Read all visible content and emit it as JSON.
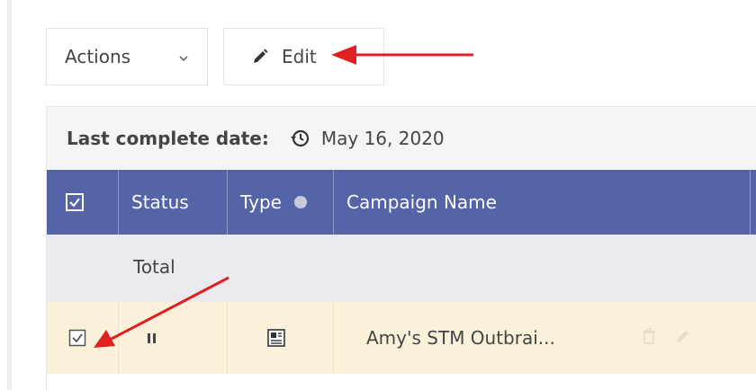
{
  "toolbar": {
    "actions_label": "Actions",
    "edit_label": "Edit"
  },
  "panel": {
    "date_label": "Last complete date:",
    "date_value": "May 16, 2020"
  },
  "table": {
    "columns": [
      "Status",
      "Type",
      "Campaign Name"
    ],
    "total_label": "Total",
    "rows": [
      {
        "selected": true,
        "status": "paused",
        "type_icon": "native-ad-icon",
        "campaign_name": "Amy's STM Outbrai..."
      }
    ]
  },
  "colors": {
    "header_bg": "#5464a6",
    "row_highlight": "#fbf1da",
    "total_row_bg": "#ebebef",
    "annotation_arrow": "#e02020"
  },
  "icons": {
    "actions_dropdown": "chevron-down-icon",
    "edit": "pencil-icon",
    "date": "history-icon",
    "type_help": "info-icon",
    "status": "pause-icon",
    "row_delete": "trash-icon",
    "row_edit": "pencil-icon"
  }
}
